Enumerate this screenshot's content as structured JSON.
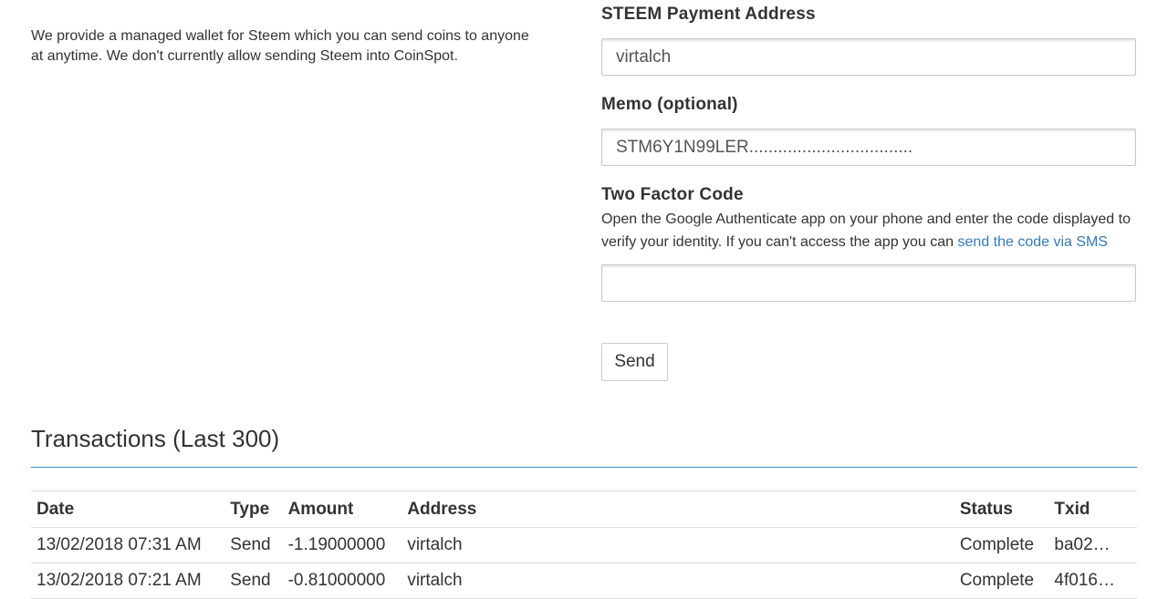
{
  "intro": {
    "text": "We provide a managed wallet for Steem which you can send coins to anyone at anytime. We don't currently allow sending Steem into CoinSpot."
  },
  "form": {
    "address_label": "STEEM Payment Address",
    "address_value": "virtalch",
    "memo_label": "Memo (optional)",
    "memo_value": "STM6Y1N99LER..................................",
    "twofa_label": "Two Factor Code",
    "twofa_help": "Open the Google Authenticate app on your phone and enter the code displayed to verify your identity. If you can't access the app you can ",
    "twofa_sms_link": "send the code via SMS",
    "twofa_value": "",
    "send_label": "Send"
  },
  "transactions": {
    "title": "Transactions (Last 300)",
    "headers": [
      "Date",
      "Type",
      "Amount",
      "Address",
      "Status",
      "Txid"
    ],
    "rows": [
      {
        "date": "13/02/2018 07:31 AM",
        "type": "Send",
        "amount": "-1.19000000",
        "address": "virtalch",
        "status": "Complete",
        "txid": "ba02…"
      },
      {
        "date": "13/02/2018 07:21 AM",
        "type": "Send",
        "amount": "-0.81000000",
        "address": "virtalch",
        "status": "Complete",
        "txid": "4f016…"
      }
    ]
  },
  "colors": {
    "link": "#337ab7",
    "rule": "#3a8fb8"
  }
}
